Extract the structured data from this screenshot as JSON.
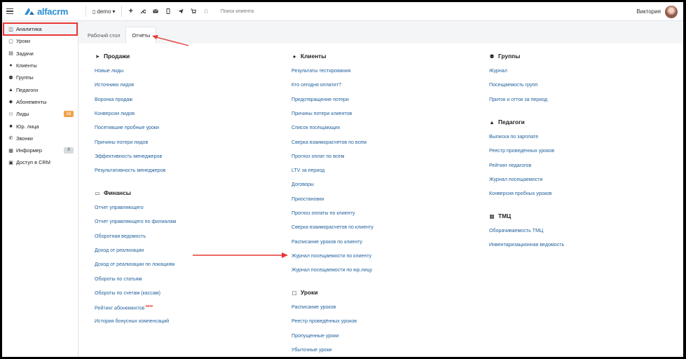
{
  "header": {
    "logo_text": "alfacrm",
    "branch": "demo",
    "search_placeholder": "Поиск клиента",
    "user_name": "Виктория",
    "accent": "#2a8fd4"
  },
  "sidebar": {
    "items": [
      {
        "label": "Аналитика",
        "icon": "chart-icon",
        "glyph": "◫",
        "active": true
      },
      {
        "label": "Уроки",
        "icon": "calendar-icon",
        "glyph": "▢"
      },
      {
        "label": "Задачи",
        "icon": "tasks-icon",
        "glyph": "▤"
      },
      {
        "label": "Клиенты",
        "icon": "user-icon",
        "glyph": "●"
      },
      {
        "label": "Группы",
        "icon": "group-icon",
        "glyph": "⚉"
      },
      {
        "label": "Педагоги",
        "icon": "graduation-cap-icon",
        "glyph": "▲"
      },
      {
        "label": "Абонементы",
        "icon": "tag-icon",
        "glyph": "◆"
      },
      {
        "label": "Лиды",
        "icon": "leads-icon",
        "glyph": "⚇",
        "badge": "28",
        "badge_color": "orange"
      },
      {
        "label": "Юр. лица",
        "icon": "briefcase-icon",
        "glyph": "■"
      },
      {
        "label": "Звонки",
        "icon": "phone-icon",
        "glyph": "✆"
      },
      {
        "label": "Информер",
        "icon": "informer-icon",
        "glyph": "▦",
        "badge": "8",
        "badge_color": "gray"
      },
      {
        "label": "Доступ в CRM",
        "icon": "lock-icon",
        "glyph": "▣"
      }
    ]
  },
  "tabs": [
    {
      "label": "Рабочий стол",
      "active": false
    },
    {
      "label": "Отчёты",
      "active": true
    }
  ],
  "reports": {
    "sales": {
      "title": "Продажи",
      "links": [
        "Новые лиды",
        "Источники лидов",
        "Воронка продаж",
        "Конверсии лидов",
        "Посетившие пробные уроки",
        "Причины потери лидов",
        "Эффективность менеджеров",
        "Результативность менеджеров"
      ]
    },
    "finance": {
      "title": "Финансы",
      "links": [
        "Отчет управляющего",
        "Отчет управляющего по филиалам",
        "Оборотная ведомость",
        "Доход от реализации",
        "Доход от реализации по локациям",
        "Обороты по статьям",
        "Обороты по счетам (кассам)",
        "Рейтинг абонементов",
        "История бонусных компенсаций"
      ],
      "new_label": "NEW"
    },
    "clients": {
      "title": "Клиенты",
      "links": [
        "Результаты тестирования",
        "Кто сегодня оплатит?",
        "Предотвращение потери",
        "Причины потери клиентов",
        "Список посещающих",
        "Сверка взаиморасчетов по всем",
        "Прогноз оплат по всем",
        "LTV за период",
        "Договоры",
        "Приостановки",
        "Прогноз оплаты по клиенту",
        "Сверка взаиморасчетов по клиенту",
        "Расписание уроков по клиенту",
        "Журнал посещаемости по клиенту",
        "Журнал посещаемости по юр.лицу"
      ]
    },
    "lessons": {
      "title": "Уроки",
      "links": [
        "Расписание уроков",
        "Реестр проведённых уроков",
        "Пропущенные уроки",
        "Убыточные уроки"
      ]
    },
    "groups": {
      "title": "Группы",
      "links": [
        "Журнал",
        "Посещаемость групп",
        "Приток и отток за период"
      ]
    },
    "teachers": {
      "title": "Педагоги",
      "links": [
        "Выписка по зарплате",
        "Реестр проведённых уроков",
        "Рейтинг педагогов",
        "Журнал посещаемости",
        "Конверсия пробных уроков"
      ]
    },
    "inventory": {
      "title": "ТМЦ",
      "links": [
        "Оборачиваемость ТМЦ",
        "Инвентаризационная ведомость"
      ]
    }
  },
  "annotation_color": "#e53935"
}
